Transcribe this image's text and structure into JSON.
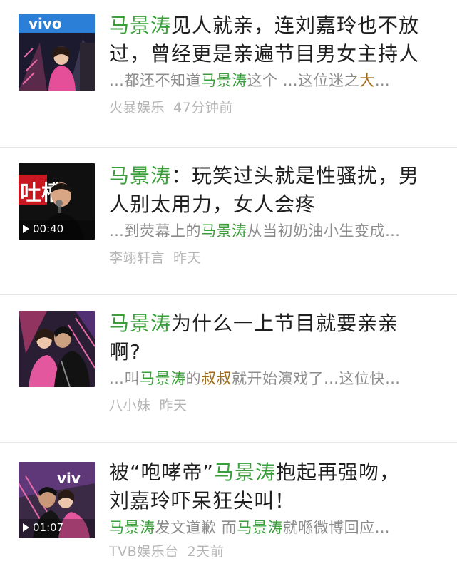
{
  "colors": {
    "highlight": "#3a9f3a",
    "keyword": "#a06a15",
    "muted": "#8c8c8c",
    "meta": "#b5b5b5"
  },
  "items": [
    {
      "title_parts": [
        "马景涛",
        "见人就亲，连刘嘉玲也不放"
      ],
      "title_line2": "过，曾经更是亲遍节目男女主持人",
      "snippet_parts": [
        "…都还不知道",
        "马景涛",
        "这个 …这位迷之",
        "大",
        "…"
      ],
      "source": "火暴娱乐",
      "time": "47分钟前",
      "thumb_icon": "stage-photo-icon",
      "thumb_text": "vivo"
    },
    {
      "title_parts": [
        "马景涛",
        "：玩笑过头就是性骚扰，男"
      ],
      "title_line2": "人别太用力，女人会疼",
      "snippet_parts": [
        "…到荧幕上的",
        "马景涛",
        "从当初奶油小生变成…"
      ],
      "source": "李翊轩言",
      "time": "昨天",
      "duration": "00:40",
      "thumb_icon": "talkshow-photo-icon",
      "thumb_text": "吐槽"
    },
    {
      "title_parts": [
        "马景涛",
        "为什么一上节目就要亲亲"
      ],
      "title_line2": "啊?",
      "snippet_parts": [
        "…叫",
        "马景涛",
        "的",
        "叔叔",
        "就开始演戏了…这位快…"
      ],
      "source": "八小妹",
      "time": "昨天",
      "thumb_icon": "kiss-photo-icon"
    },
    {
      "title_parts": [
        "被“咆哮帝”",
        "马景涛",
        "抱起再强吻，"
      ],
      "title_line2": "刘嘉玲吓呆狂尖叫！",
      "snippet_parts": [
        "马景涛",
        "发文道歉 而",
        "马景涛",
        "就喺微博回应…"
      ],
      "source": "TVB娱乐台",
      "time": "2天前",
      "duration": "01:07",
      "thumb_icon": "hug-photo-icon",
      "thumb_text": "viv"
    }
  ]
}
